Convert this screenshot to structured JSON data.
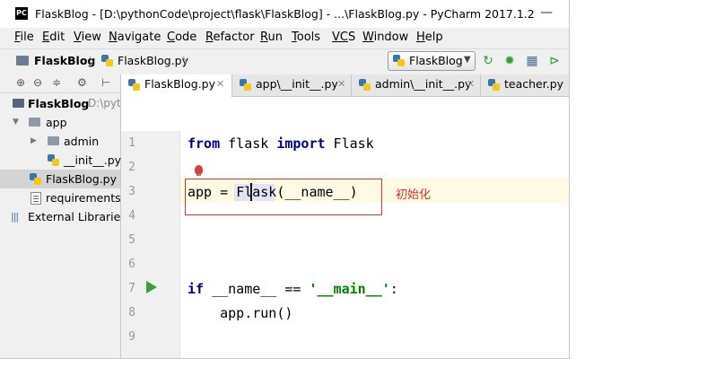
{
  "window": {
    "app_icon": "PC",
    "title": "FlaskBlog - [D:\\pythonCode\\project\\flask\\FlaskBlog] - ...\\FlaskBlog.py - PyCharm 2017.1.2",
    "minimize_glyph": "—"
  },
  "menu": [
    {
      "mn": "F",
      "rest": "ile"
    },
    {
      "mn": "E",
      "rest": "dit"
    },
    {
      "mn": "V",
      "rest": "iew"
    },
    {
      "mn": "N",
      "rest": "avigate"
    },
    {
      "mn": "C",
      "rest": "ode"
    },
    {
      "mn": "R",
      "rest": "efactor"
    },
    {
      "mn": "R",
      "rest": "un"
    },
    {
      "mn": "T",
      "rest": "ools"
    },
    {
      "mn": "VC",
      "rest": "S"
    },
    {
      "mn": "W",
      "rest": "indow"
    },
    {
      "mn": "H",
      "rest": "elp"
    }
  ],
  "navbar": {
    "project_crumb": "FlaskBlog",
    "file_crumb": "FlaskBlog.py",
    "separator": "〉",
    "run_config": "FlaskBlog"
  },
  "sidebar": {
    "tree": [
      {
        "label": "FlaskBlog",
        "suffix": "D:\\pyt",
        "kind": "project"
      },
      {
        "label": "app",
        "kind": "folder"
      },
      {
        "label": "admin",
        "kind": "folder"
      },
      {
        "label": "__init__.py",
        "kind": "py"
      },
      {
        "label": "FlaskBlog.py",
        "kind": "py",
        "selected": true
      },
      {
        "label": "requirements.t",
        "kind": "txt"
      },
      {
        "label": "External Libraries",
        "kind": "lib"
      }
    ]
  },
  "tabs": [
    {
      "label": "FlaskBlog.py",
      "active": true
    },
    {
      "label": "app\\__init__.py"
    },
    {
      "label": "admin\\__init__.py"
    },
    {
      "label": "teacher.py"
    }
  ],
  "editor": {
    "line_numbers": [
      "1",
      "2",
      "3",
      "4",
      "5",
      "6",
      "7",
      "8",
      "9"
    ],
    "lines": {
      "l1_kw1": "from",
      "l1_mid": " flask ",
      "l1_kw2": "import",
      "l1_end": " Flask",
      "l3_a": "app = ",
      "l3_b": "Flask",
      "l3_c": "(__name__)",
      "l7_kw": "if",
      "l7_mid": " __name__ == ",
      "l7_str": "'__main__'",
      "l7_end": ":",
      "l8": "    app.run()"
    },
    "annotation": "初始化",
    "current_line": 3
  },
  "colors": {
    "keyword": "#000080",
    "string": "#008000",
    "annotation": "#d03030",
    "current_line_bg": "#fffae3"
  }
}
